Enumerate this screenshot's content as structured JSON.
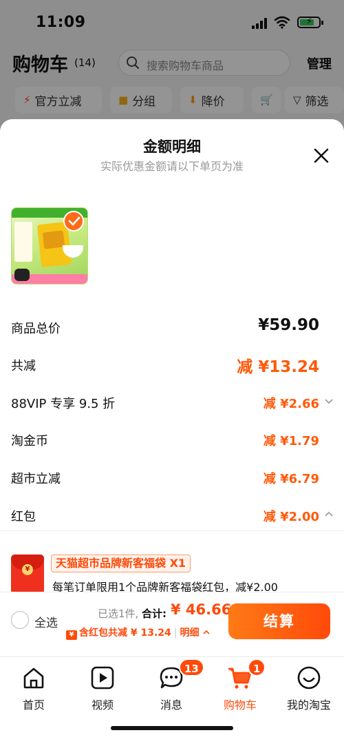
{
  "status_bar": {
    "time": "11:09"
  },
  "cart_header": {
    "title": "购物车",
    "count": "(14)",
    "search_placeholder": "搜索购物车商品",
    "manage_label": "管理"
  },
  "filter_chips": [
    {
      "label": "官方立减",
      "icon": "lightning-icon"
    },
    {
      "label": "分组",
      "icon": "folder-icon"
    },
    {
      "label": "降价",
      "icon": "down-arrow-icon"
    },
    {
      "label": "",
      "icon": "cart-icon"
    },
    {
      "label": "筛选",
      "icon": "filter-icon"
    }
  ],
  "sheet": {
    "title": "金额明细",
    "subtitle": "实际优惠金额请以下单页为准",
    "rows": [
      {
        "label": "商品总价",
        "value": "¥59.90"
      },
      {
        "label": "共减",
        "value": "减 ¥13.24"
      },
      {
        "label": "88VIP 专享 9.5 折",
        "value": "减 ¥2.66"
      },
      {
        "label": "淘金币",
        "value": "减 ¥1.79"
      },
      {
        "label": "超市立减",
        "value": "减 ¥6.79"
      },
      {
        "label": "红包",
        "value": "减 ¥2.00"
      }
    ],
    "red_packet": {
      "tag": "天猫超市品牌新客福袋 X1",
      "description": "每笔订单限用1个品牌新客福袋红包，减¥2.00"
    }
  },
  "checkout": {
    "select_all_label": "全选",
    "selected_count": "已选1件,",
    "total_label": "合计:",
    "total_amount": "¥ 46.66",
    "redpacket_summary": "含红包共减 ¥ 13.24",
    "detail_label": "明细",
    "checkout_button": "结算"
  },
  "tabbar": [
    {
      "label": "首页",
      "icon": "home-icon"
    },
    {
      "label": "视频",
      "icon": "video-icon"
    },
    {
      "label": "消息",
      "icon": "message-icon",
      "badge": "13"
    },
    {
      "label": "购物车",
      "icon": "cart-icon",
      "badge": "1",
      "active": true
    },
    {
      "label": "我的淘宝",
      "icon": "profile-icon"
    }
  ],
  "colors": {
    "accent": "#ff4a0a",
    "accent_light": "#ff7a16",
    "text": "#111111",
    "muted": "#999999"
  }
}
